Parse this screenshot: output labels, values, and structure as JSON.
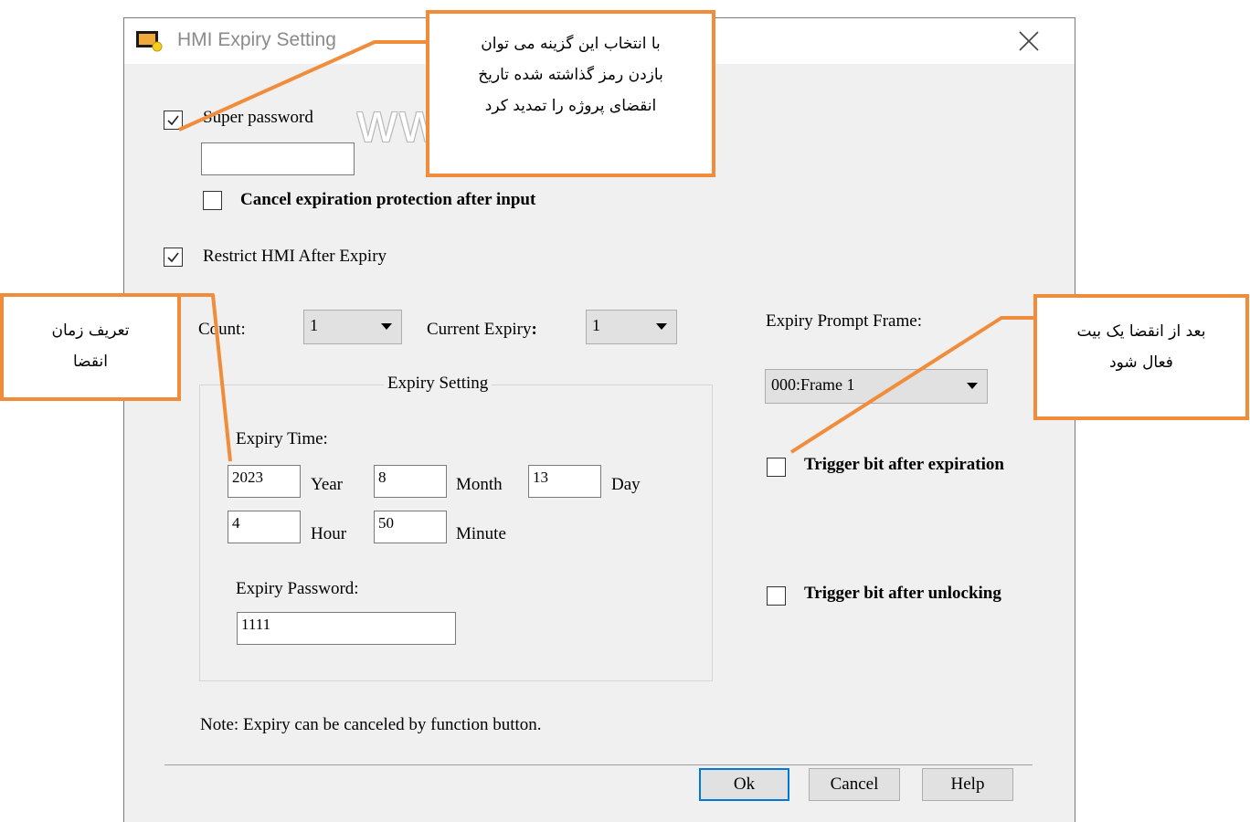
{
  "window": {
    "title": "HMI Expiry Setting",
    "watermark": "www.          t.com"
  },
  "super_password": {
    "label": "Super password",
    "checked": true,
    "value": ""
  },
  "cancel_protection": {
    "label": "Cancel expiration protection after input",
    "checked": false
  },
  "restrict": {
    "label": "Restrict HMI After Expiry",
    "checked": true
  },
  "count": {
    "label": "Count:",
    "value": "1"
  },
  "current_expiry": {
    "label": "Current Expiry",
    "colon": ":",
    "value": "1"
  },
  "expiry_setting": {
    "group_title": "Expiry Setting",
    "time_label": "Expiry Time:",
    "year": {
      "value": "2023",
      "label": "Year"
    },
    "month": {
      "value": "8",
      "label": "Month"
    },
    "day": {
      "value": "13",
      "label": "Day"
    },
    "hour": {
      "value": "4",
      "label": "Hour"
    },
    "minute": {
      "value": "50",
      "label": "Minute"
    },
    "password_label": "Expiry Password:",
    "password_value": "1111"
  },
  "prompt_frame": {
    "label": "Expiry Prompt Frame:",
    "value": "000:Frame 1"
  },
  "trigger_expiration": {
    "label": "Trigger bit after expiration",
    "checked": false
  },
  "trigger_unlocking": {
    "label": "Trigger bit after unlocking",
    "checked": false
  },
  "note": "Note: Expiry can be canceled by function button.",
  "buttons": {
    "ok": "Ok",
    "cancel": "Cancel",
    "help": "Help"
  },
  "callouts": {
    "top_line1": "با انتخاب این گزینه می توان",
    "top_line2": "بازدن رمز گذاشته شده تاریخ",
    "top_line3": "انقضای پروژه را تمدید کرد",
    "left_line1": "تعریف زمان",
    "left_line2": "انقضا",
    "right_line1": "بعد از انقضا یک بیت",
    "right_line2": "فعال شود"
  },
  "colors": {
    "callout_border": "#f08c3a",
    "dialog_bg": "#f0f0f0",
    "default_button_border": "#0078d7"
  },
  "icons": [
    "app-icon",
    "close-icon",
    "checkmark-icon",
    "dropdown-arrow-icon"
  ]
}
